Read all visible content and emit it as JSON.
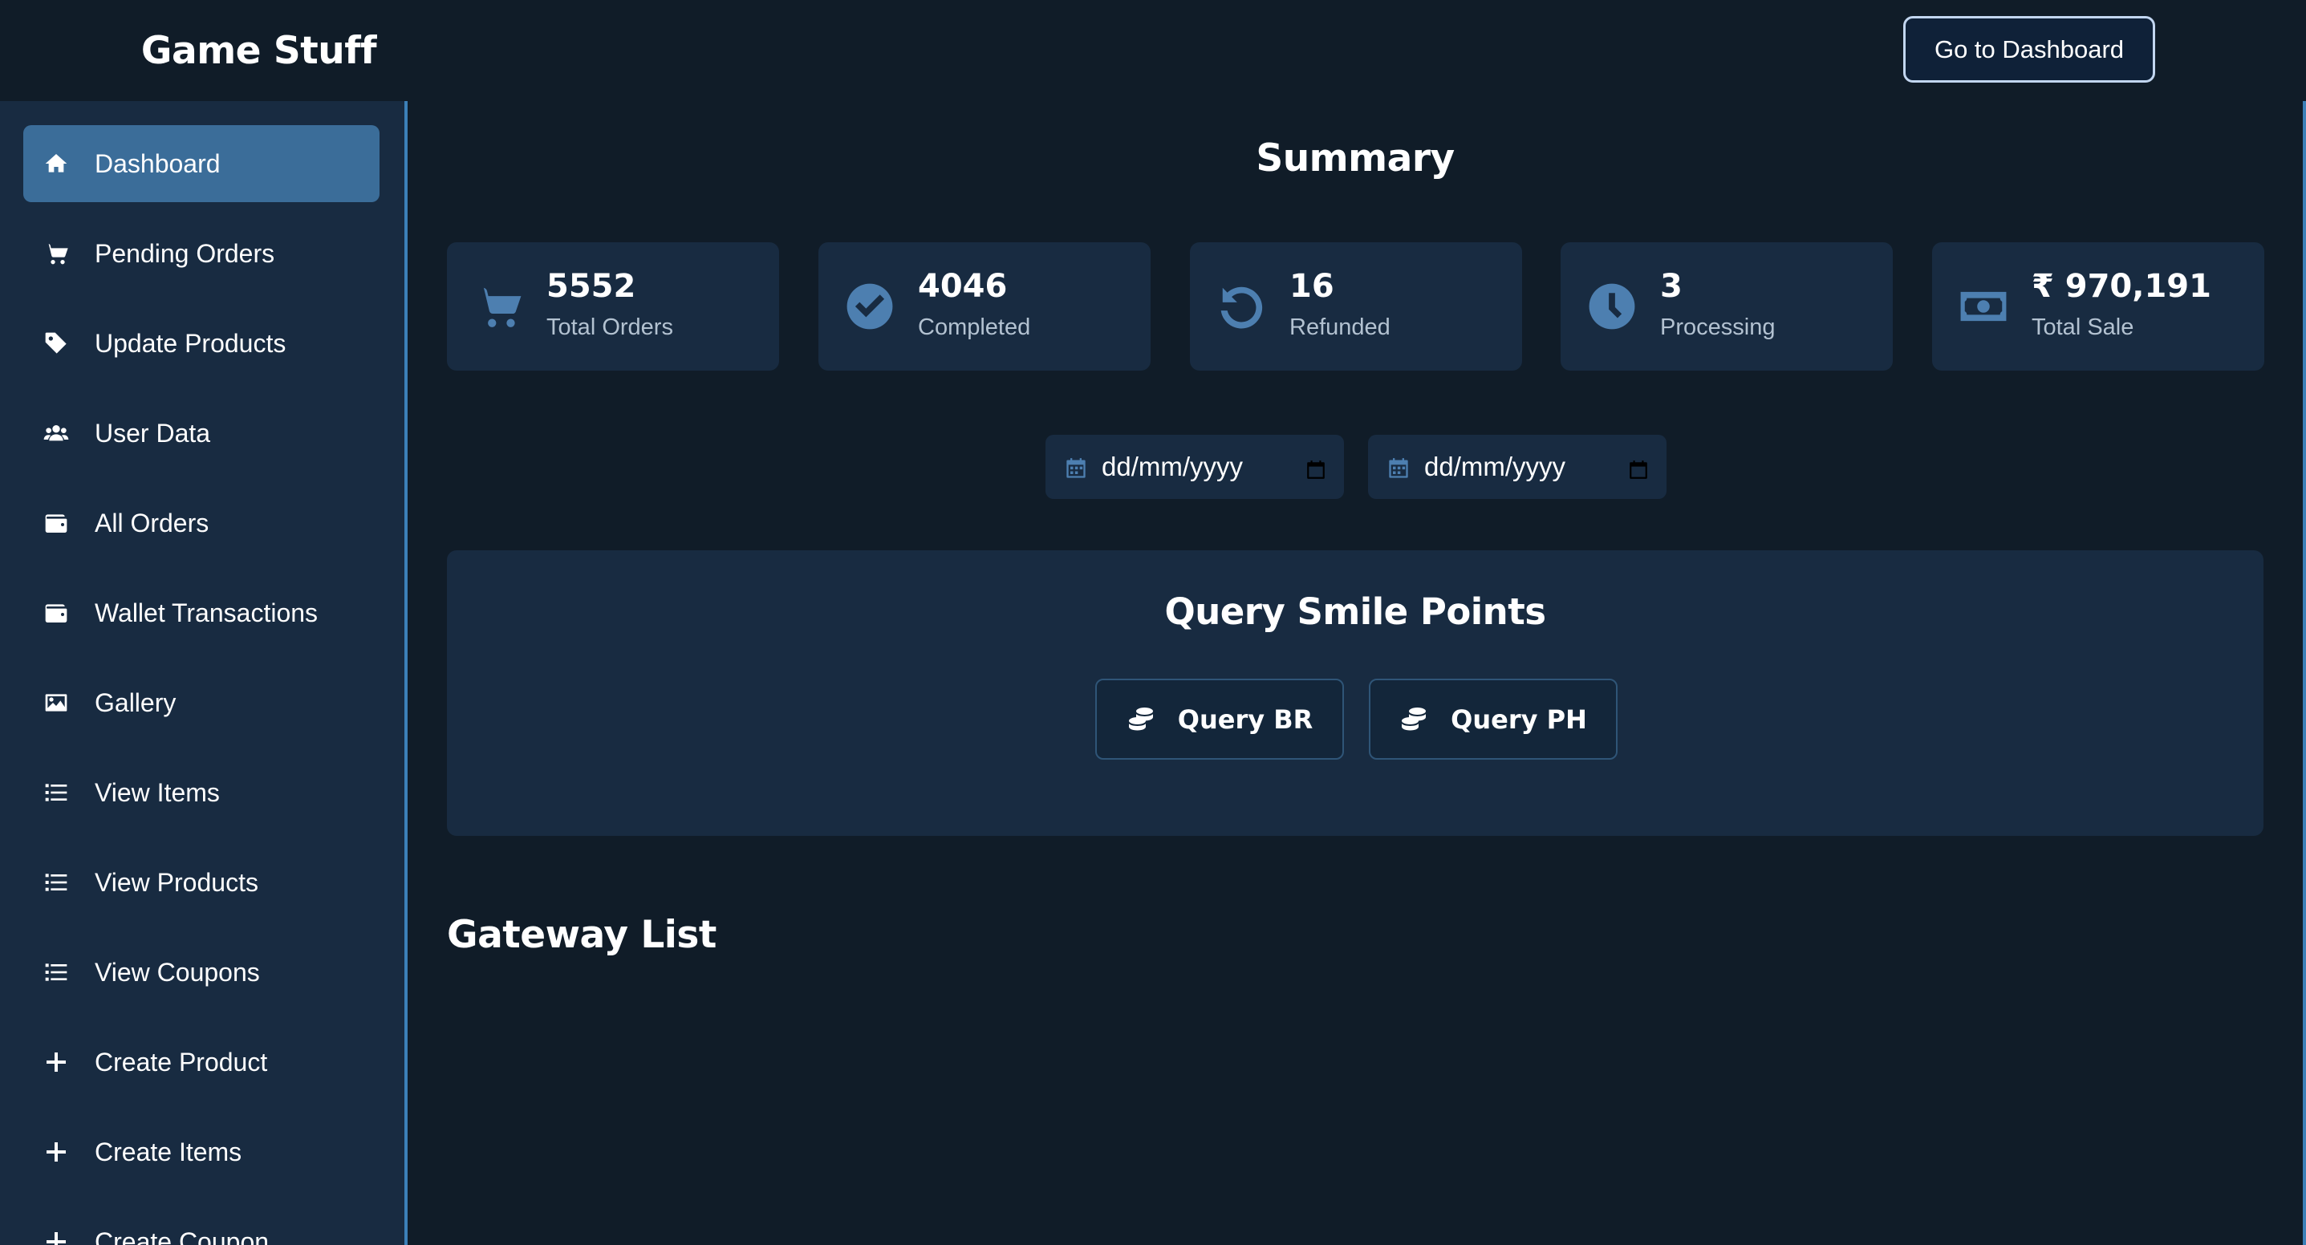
{
  "header": {
    "brand": "Game Stuff",
    "dashboard_button": "Go to Dashboard"
  },
  "sidebar": {
    "items": [
      {
        "label": "Dashboard",
        "icon": "home-icon",
        "active": true
      },
      {
        "label": "Pending Orders",
        "icon": "cart-icon"
      },
      {
        "label": "Update Products",
        "icon": "tag-icon"
      },
      {
        "label": "User Data",
        "icon": "users-icon"
      },
      {
        "label": "All Orders",
        "icon": "wallet-icon"
      },
      {
        "label": "Wallet Transactions",
        "icon": "wallet-icon"
      },
      {
        "label": "Gallery",
        "icon": "image-icon"
      },
      {
        "label": "View Items",
        "icon": "list-icon"
      },
      {
        "label": "View Products",
        "icon": "list-icon"
      },
      {
        "label": "View Coupons",
        "icon": "list-icon"
      },
      {
        "label": "Create Product",
        "icon": "plus-icon"
      },
      {
        "label": "Create Items",
        "icon": "plus-icon"
      },
      {
        "label": "Create Coupon",
        "icon": "plus-icon"
      }
    ]
  },
  "summary": {
    "title": "Summary",
    "cards": [
      {
        "value": "5552",
        "label": "Total Orders",
        "icon": "cart-icon"
      },
      {
        "value": "4046",
        "label": "Completed",
        "icon": "check-circle-icon"
      },
      {
        "value": "16",
        "label": "Refunded",
        "icon": "undo-icon"
      },
      {
        "value": "3",
        "label": "Processing",
        "icon": "clock-icon"
      },
      {
        "value": "₹ 970,191",
        "label": "Total Sale",
        "icon": "money-bill-icon"
      }
    ]
  },
  "date_filter": {
    "start_placeholder": "dd/mm/yyyy",
    "end_placeholder": "dd/mm/yyyy"
  },
  "smile_points": {
    "title": "Query Smile Points",
    "buttons": [
      "Query BR",
      "Query PH"
    ]
  },
  "gateway": {
    "title": "Gateway List"
  },
  "colors": {
    "background": "#101c28",
    "panel": "#182b41",
    "active_nav": "#3b6d99",
    "accent_border": "#3c80b8",
    "icon_accent": "#4d7fb0"
  }
}
